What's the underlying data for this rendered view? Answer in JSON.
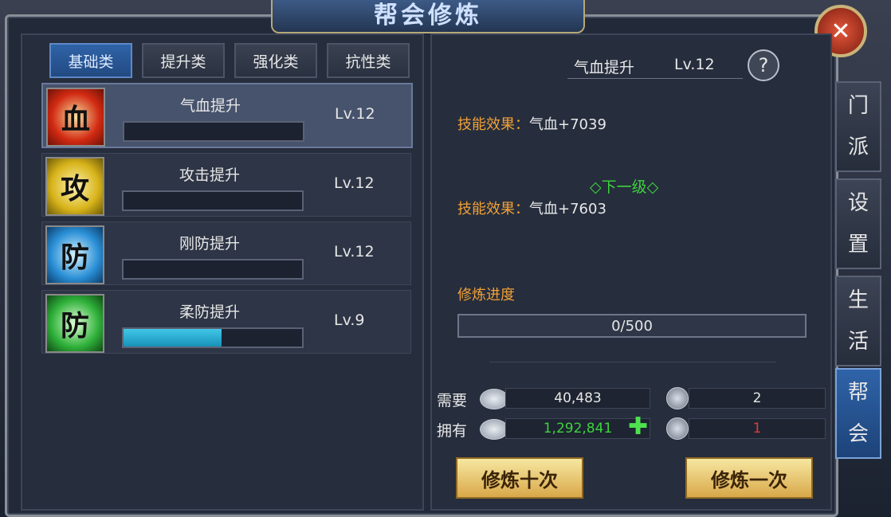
{
  "window": {
    "title": "帮会修炼",
    "close_icon": "close-icon"
  },
  "tabs": [
    {
      "label": "基础类",
      "active": true
    },
    {
      "label": "提升类",
      "active": false
    },
    {
      "label": "强化类",
      "active": false
    },
    {
      "label": "抗性类",
      "active": false
    }
  ],
  "skills": [
    {
      "name": "气血提升",
      "level": "Lv.12",
      "icon_char": "血",
      "progress": 0,
      "active": true
    },
    {
      "name": "攻击提升",
      "level": "Lv.12",
      "icon_char": "攻",
      "progress": 0,
      "active": false
    },
    {
      "name": "刚防提升",
      "level": "Lv.12",
      "icon_char": "防",
      "progress": 0,
      "active": false
    },
    {
      "name": "柔防提升",
      "level": "Lv.9",
      "icon_char": "防",
      "progress": 0.55,
      "active": false
    }
  ],
  "detail": {
    "title": "气血提升",
    "level": "Lv.12",
    "help": "?",
    "effect_label": "技能效果：",
    "effect_current": "气血+7039",
    "next_label": "◇下一级◇",
    "effect_next": "气血+7603",
    "progress_label": "修炼进度",
    "progress_text": "0/500"
  },
  "resources": {
    "need_label": "需要",
    "have_label": "拥有",
    "need_silver": "40,483",
    "have_silver": "1,292,841",
    "need_token": "2",
    "have_token": "1",
    "plus": "✚"
  },
  "buttons": {
    "train_ten": "修炼十次",
    "train_once": "修炼一次"
  },
  "side_tabs": [
    {
      "label": "门派",
      "chars": [
        "门",
        "派"
      ],
      "active": false
    },
    {
      "label": "设置",
      "chars": [
        "设",
        "置"
      ],
      "active": false
    },
    {
      "label": "生活",
      "chars": [
        "生",
        "活"
      ],
      "active": false
    },
    {
      "label": "帮会",
      "chars": [
        "帮",
        "会"
      ],
      "active": true
    }
  ],
  "colors": {
    "accent_orange": "#f1a136",
    "green": "#3ed23e",
    "red": "#e03a3a",
    "bar_fill": "#1792b8"
  }
}
